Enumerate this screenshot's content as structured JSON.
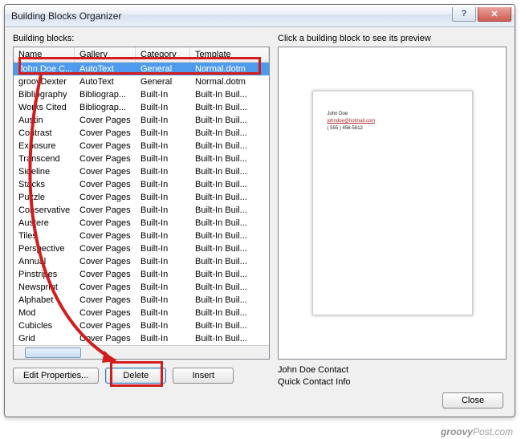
{
  "titlebar": {
    "title": "Building Blocks Organizer"
  },
  "labels": {
    "building_blocks": "Building blocks:",
    "preview_hint": "Click a building block to see its preview"
  },
  "columns": {
    "name": "Name",
    "gallery": "Gallery",
    "category": "Category",
    "template": "Template"
  },
  "rows": [
    {
      "name": "John Doe C...",
      "gallery": "AutoText",
      "category": "General",
      "template": "Normal.dotm",
      "selected": true
    },
    {
      "name": "groovDexter",
      "gallery": "AutoText",
      "category": "General",
      "template": "Normal.dotm"
    },
    {
      "name": "Bibliography",
      "gallery": "Bibliograp...",
      "category": "Built-In",
      "template": "Built-In Buil..."
    },
    {
      "name": "Works Cited",
      "gallery": "Bibliograp...",
      "category": "Built-In",
      "template": "Built-In Buil..."
    },
    {
      "name": "Austin",
      "gallery": "Cover Pages",
      "category": "Built-In",
      "template": "Built-In Buil..."
    },
    {
      "name": "Contrast",
      "gallery": "Cover Pages",
      "category": "Built-In",
      "template": "Built-In Buil..."
    },
    {
      "name": "Exposure",
      "gallery": "Cover Pages",
      "category": "Built-In",
      "template": "Built-In Buil..."
    },
    {
      "name": "Transcend",
      "gallery": "Cover Pages",
      "category": "Built-In",
      "template": "Built-In Buil..."
    },
    {
      "name": "Sideline",
      "gallery": "Cover Pages",
      "category": "Built-In",
      "template": "Built-In Buil..."
    },
    {
      "name": "Stacks",
      "gallery": "Cover Pages",
      "category": "Built-In",
      "template": "Built-In Buil..."
    },
    {
      "name": "Puzzle",
      "gallery": "Cover Pages",
      "category": "Built-In",
      "template": "Built-In Buil..."
    },
    {
      "name": "Conservative",
      "gallery": "Cover Pages",
      "category": "Built-In",
      "template": "Built-In Buil..."
    },
    {
      "name": "Austere",
      "gallery": "Cover Pages",
      "category": "Built-In",
      "template": "Built-In Buil..."
    },
    {
      "name": "Tiles",
      "gallery": "Cover Pages",
      "category": "Built-In",
      "template": "Built-In Buil..."
    },
    {
      "name": "Perspective",
      "gallery": "Cover Pages",
      "category": "Built-In",
      "template": "Built-In Buil..."
    },
    {
      "name": "Annual",
      "gallery": "Cover Pages",
      "category": "Built-In",
      "template": "Built-In Buil..."
    },
    {
      "name": "Pinstripes",
      "gallery": "Cover Pages",
      "category": "Built-In",
      "template": "Built-In Buil..."
    },
    {
      "name": "Newsprint",
      "gallery": "Cover Pages",
      "category": "Built-In",
      "template": "Built-In Buil..."
    },
    {
      "name": "Alphabet",
      "gallery": "Cover Pages",
      "category": "Built-In",
      "template": "Built-In Buil..."
    },
    {
      "name": "Mod",
      "gallery": "Cover Pages",
      "category": "Built-In",
      "template": "Built-In Buil..."
    },
    {
      "name": "Cubicles",
      "gallery": "Cover Pages",
      "category": "Built-In",
      "template": "Built-In Buil..."
    },
    {
      "name": "Grid",
      "gallery": "Cover Pages",
      "category": "Built-In",
      "template": "Built-In Buil..."
    }
  ],
  "buttons": {
    "edit_properties": "Edit Properties...",
    "delete": "Delete",
    "insert": "Insert",
    "close": "Close"
  },
  "preview_meta": {
    "line1": "John Doe Contact",
    "line2": "Quick Contact Info"
  },
  "preview_page": {
    "name": "John Doe",
    "email": "johndoe@hotmail.com",
    "phone": "( 555 ) 456-5812"
  },
  "watermark": {
    "prefix": "groovy",
    "suffix": "Post.com"
  }
}
